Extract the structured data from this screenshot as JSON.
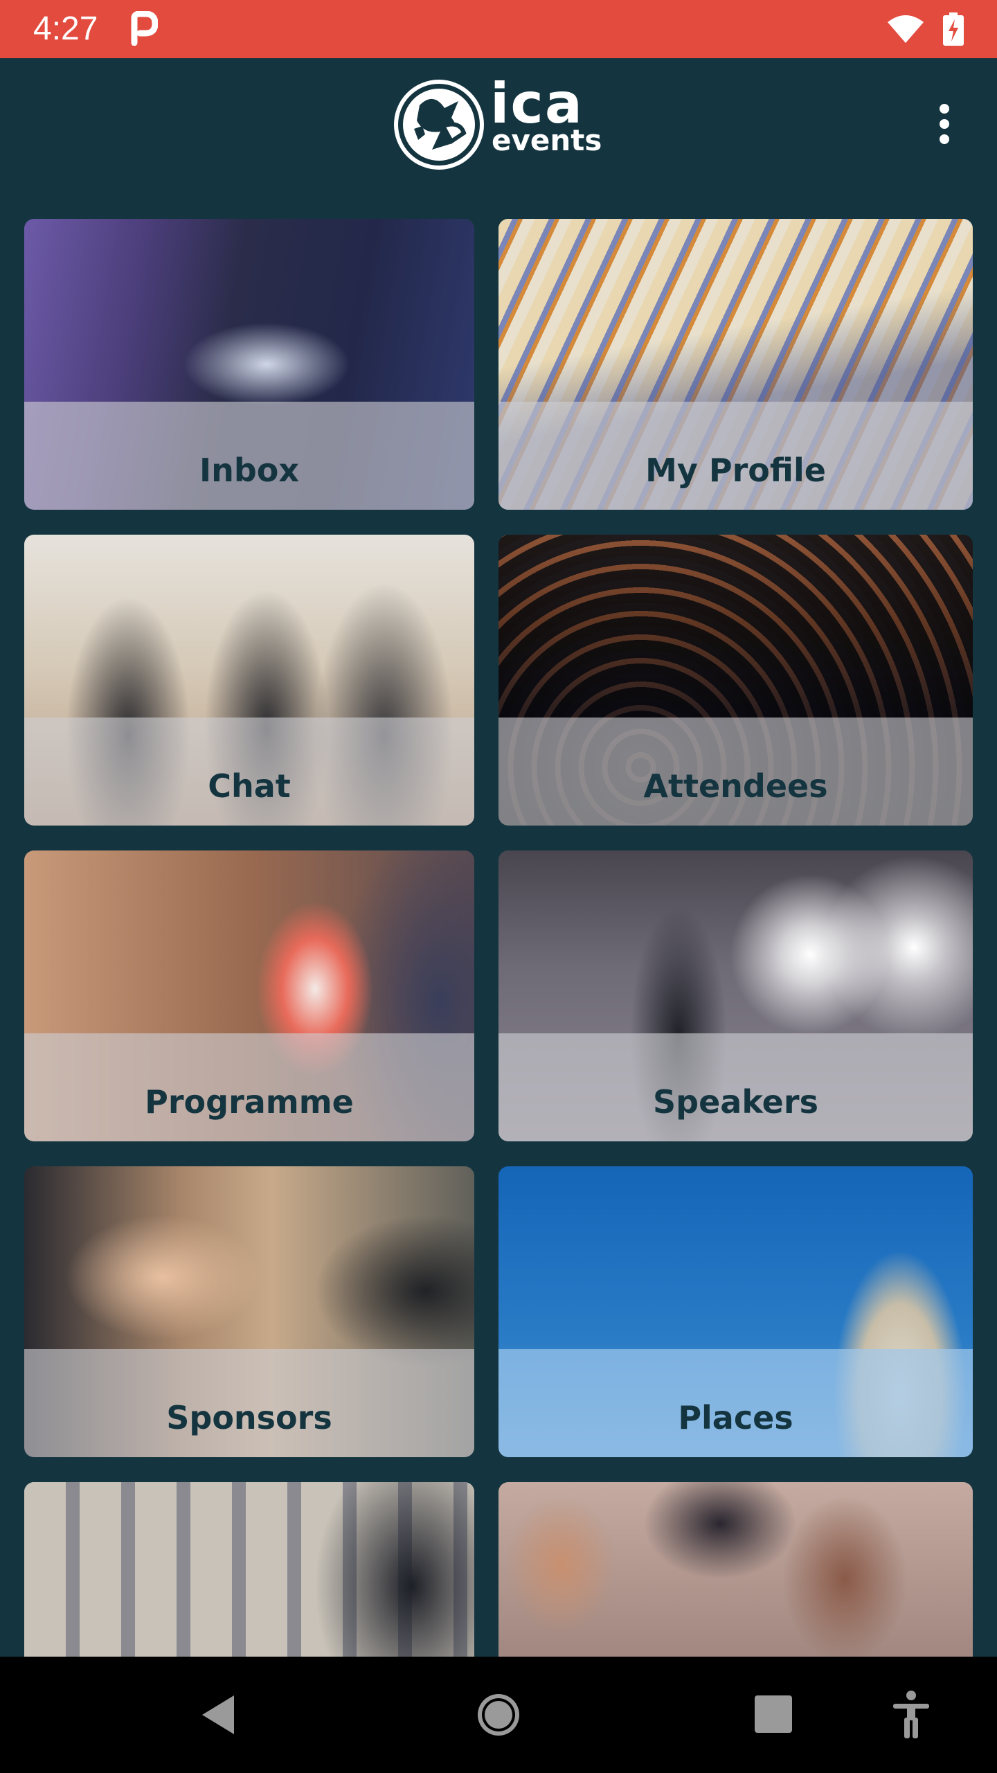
{
  "status_bar": {
    "time": "4:27",
    "color": "#e34b3f",
    "icons": [
      "parking-p-icon",
      "wifi-icon",
      "battery-charging-icon"
    ]
  },
  "app_bar": {
    "logo_text_main": "ica",
    "logo_text_sub": "events",
    "menu_icon": "more-vertical-icon",
    "background": "#143540"
  },
  "tiles": [
    {
      "label": "Inbox",
      "name": "tile-inbox"
    },
    {
      "label": "My Profile",
      "name": "tile-my-profile"
    },
    {
      "label": "Chat",
      "name": "tile-chat"
    },
    {
      "label": "Attendees",
      "name": "tile-attendees"
    },
    {
      "label": "Programme",
      "name": "tile-programme"
    },
    {
      "label": "Speakers",
      "name": "tile-speakers"
    },
    {
      "label": "Sponsors",
      "name": "tile-sponsors"
    },
    {
      "label": "Places",
      "name": "tile-places"
    }
  ],
  "nav_bar": {
    "icons": [
      "back-triangle-icon",
      "home-circle-icon",
      "recents-square-icon",
      "accessibility-icon"
    ]
  }
}
